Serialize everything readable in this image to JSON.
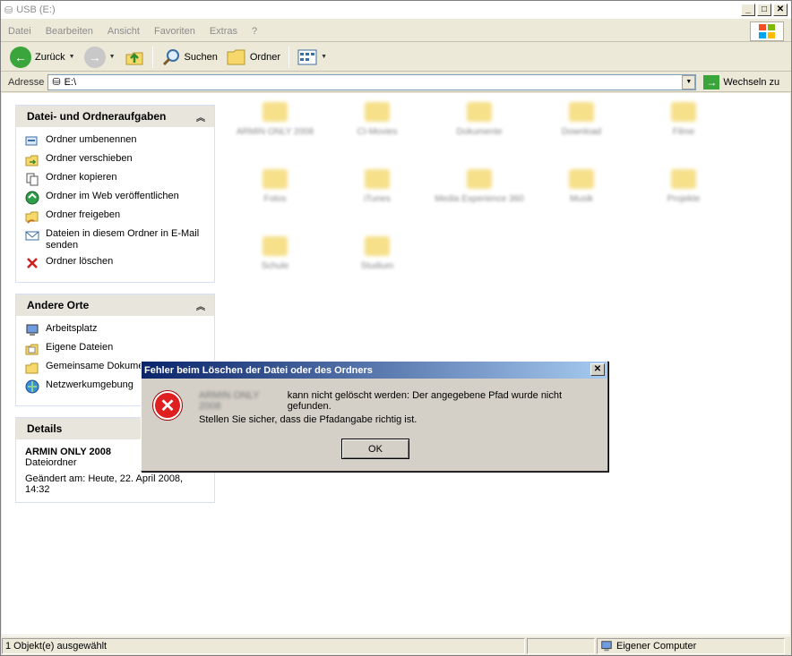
{
  "window": {
    "title": "USB (E:)"
  },
  "menu": [
    "Datei",
    "Bearbeiten",
    "Ansicht",
    "Favoriten",
    "Extras",
    "?"
  ],
  "toolbar": {
    "back": "Zurück",
    "search": "Suchen",
    "folders": "Ordner"
  },
  "address": {
    "label": "Adresse",
    "value": "E:\\",
    "go": "Wechseln zu"
  },
  "taskpane": {
    "file_tasks": {
      "header": "Datei- und Ordneraufgaben",
      "items": [
        {
          "label": "Ordner umbenennen",
          "icon": "rename-icon"
        },
        {
          "label": "Ordner verschieben",
          "icon": "move-icon"
        },
        {
          "label": "Ordner kopieren",
          "icon": "copy-icon"
        },
        {
          "label": "Ordner im Web veröffentlichen",
          "icon": "publish-web-icon"
        },
        {
          "label": "Ordner freigeben",
          "icon": "share-icon"
        },
        {
          "label": "Dateien in diesem Ordner in E-Mail senden",
          "icon": "email-icon"
        },
        {
          "label": "Ordner löschen",
          "icon": "delete-icon"
        }
      ]
    },
    "other_places": {
      "header": "Andere Orte",
      "items": [
        {
          "label": "Arbeitsplatz",
          "icon": "computer-icon"
        },
        {
          "label": "Eigene Dateien",
          "icon": "my-documents-icon"
        },
        {
          "label": "Gemeinsame Dokumente",
          "icon": "shared-docs-icon"
        },
        {
          "label": "Netzwerkumgebung",
          "icon": "network-icon"
        }
      ]
    },
    "details": {
      "header": "Details",
      "name": "ARMIN ONLY 2008",
      "type": "Dateiordner",
      "modified": "Geändert am: Heute, 22. April 2008, 14:32"
    }
  },
  "files": [
    "ARMIN ONLY 2008",
    "CI-Movies",
    "Dokumente",
    "Download",
    "Filme",
    "Fotos",
    "iTunes",
    "Media Experience 360",
    "Musik",
    "Projekte",
    "Schule",
    "Studium"
  ],
  "statusbar": {
    "selection": "1 Objekt(e) ausgewählt",
    "zone": "Eigener Computer"
  },
  "dialog": {
    "title": "Fehler beim Löschen der Datei oder des Ordners",
    "subject": "ARMIN ONLY 2008",
    "message": "kann nicht gelöscht werden: Der angegebene Pfad wurde nicht gefunden.",
    "hint": "Stellen Sie sicher, dass die Pfadangabe richtig ist.",
    "ok": "OK"
  },
  "colors": {
    "dialog_title_start": "#0a246a",
    "dialog_title_end": "#a6caf0",
    "error": "#e02020",
    "folder": "#f6e08a"
  }
}
